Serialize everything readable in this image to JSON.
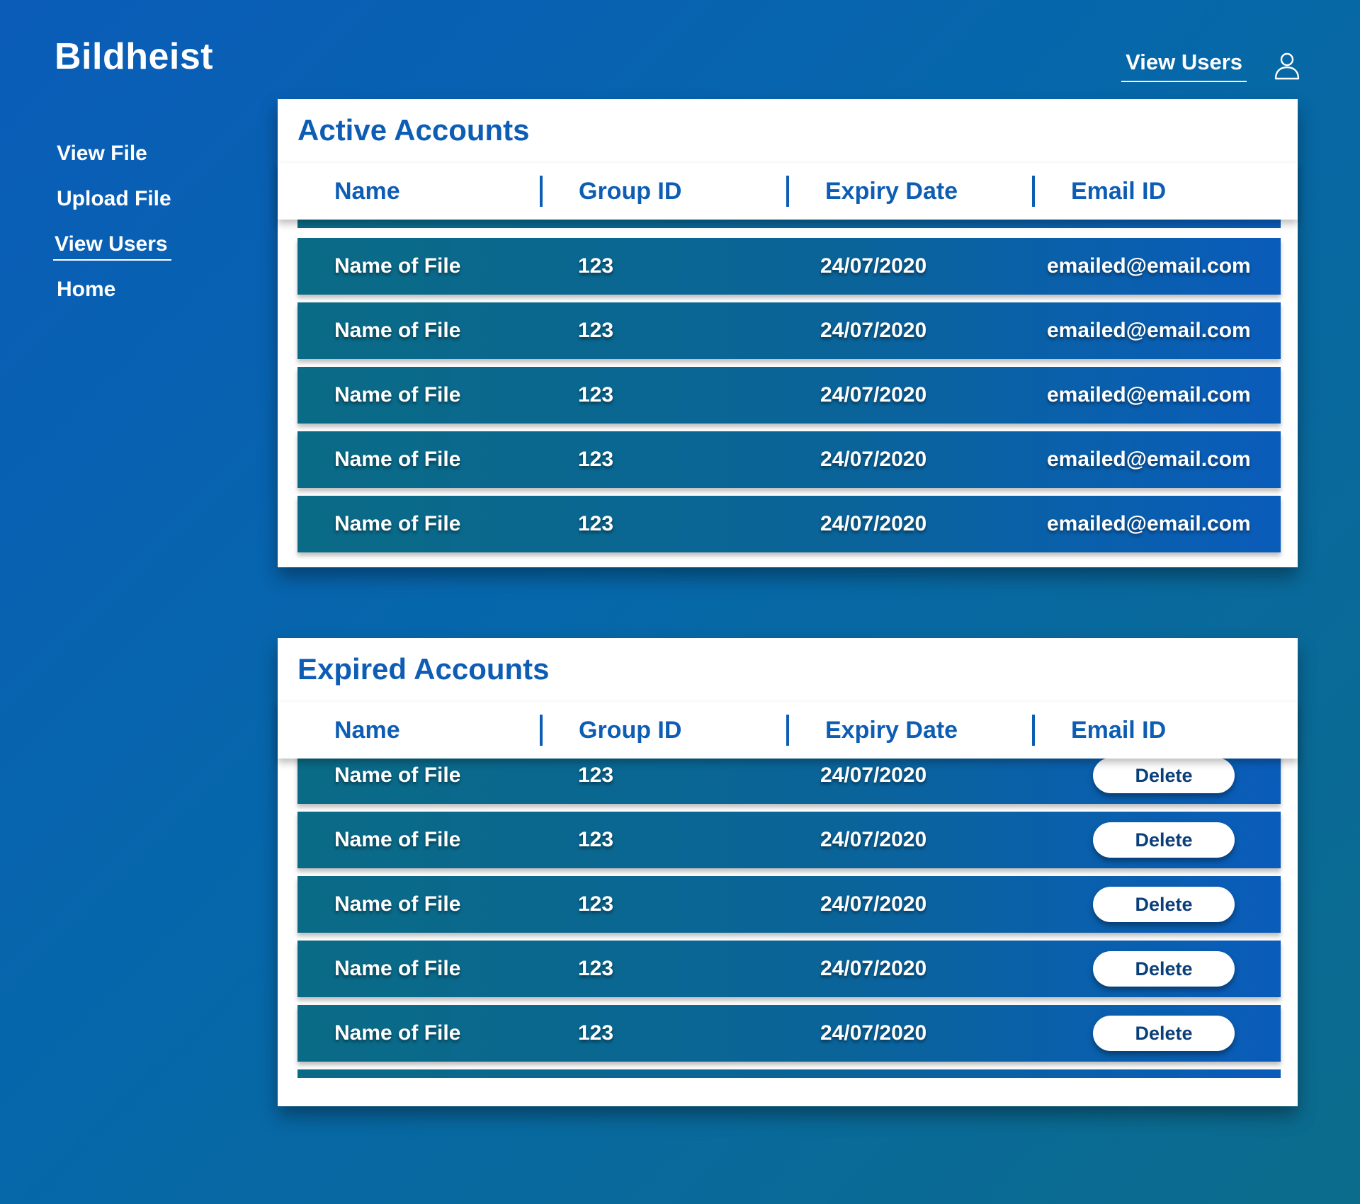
{
  "app": {
    "title": "Bildheist"
  },
  "header": {
    "view_users_link": "View Users"
  },
  "sidebar": {
    "items": [
      {
        "label": "View File"
      },
      {
        "label": "Upload File"
      },
      {
        "label": "View Users"
      },
      {
        "label": "Home"
      }
    ],
    "active_index": 2
  },
  "active_accounts": {
    "title": "Active Accounts",
    "columns": [
      "Name",
      "Group ID",
      "Expiry Date",
      "Email ID"
    ],
    "rows": [
      {
        "name": "Name of File",
        "group_id": "123",
        "expiry": "24/07/2020",
        "email": "emailed@email.com"
      },
      {
        "name": "Name of File",
        "group_id": "123",
        "expiry": "24/07/2020",
        "email": "emailed@email.com"
      },
      {
        "name": "Name of File",
        "group_id": "123",
        "expiry": "24/07/2020",
        "email": "emailed@email.com"
      },
      {
        "name": "Name of File",
        "group_id": "123",
        "expiry": "24/07/2020",
        "email": "emailed@email.com"
      },
      {
        "name": "Name of File",
        "group_id": "123",
        "expiry": "24/07/2020",
        "email": "emailed@email.com"
      }
    ]
  },
  "expired_accounts": {
    "title": "Expired Accounts",
    "columns": [
      "Name",
      "Group ID",
      "Expiry Date",
      "Email ID"
    ],
    "delete_label": "Delete",
    "rows": [
      {
        "name": "Name of File",
        "group_id": "123",
        "expiry": "24/07/2020"
      },
      {
        "name": "Name of File",
        "group_id": "123",
        "expiry": "24/07/2020"
      },
      {
        "name": "Name of File",
        "group_id": "123",
        "expiry": "24/07/2020"
      },
      {
        "name": "Name of File",
        "group_id": "123",
        "expiry": "24/07/2020"
      },
      {
        "name": "Name of File",
        "group_id": "123",
        "expiry": "24/07/2020"
      }
    ]
  },
  "icons": {
    "profile": "user-icon"
  },
  "colors": {
    "accent": "#0e5db4",
    "row_start": "#0a6b86",
    "row_end": "#0a5cba"
  }
}
